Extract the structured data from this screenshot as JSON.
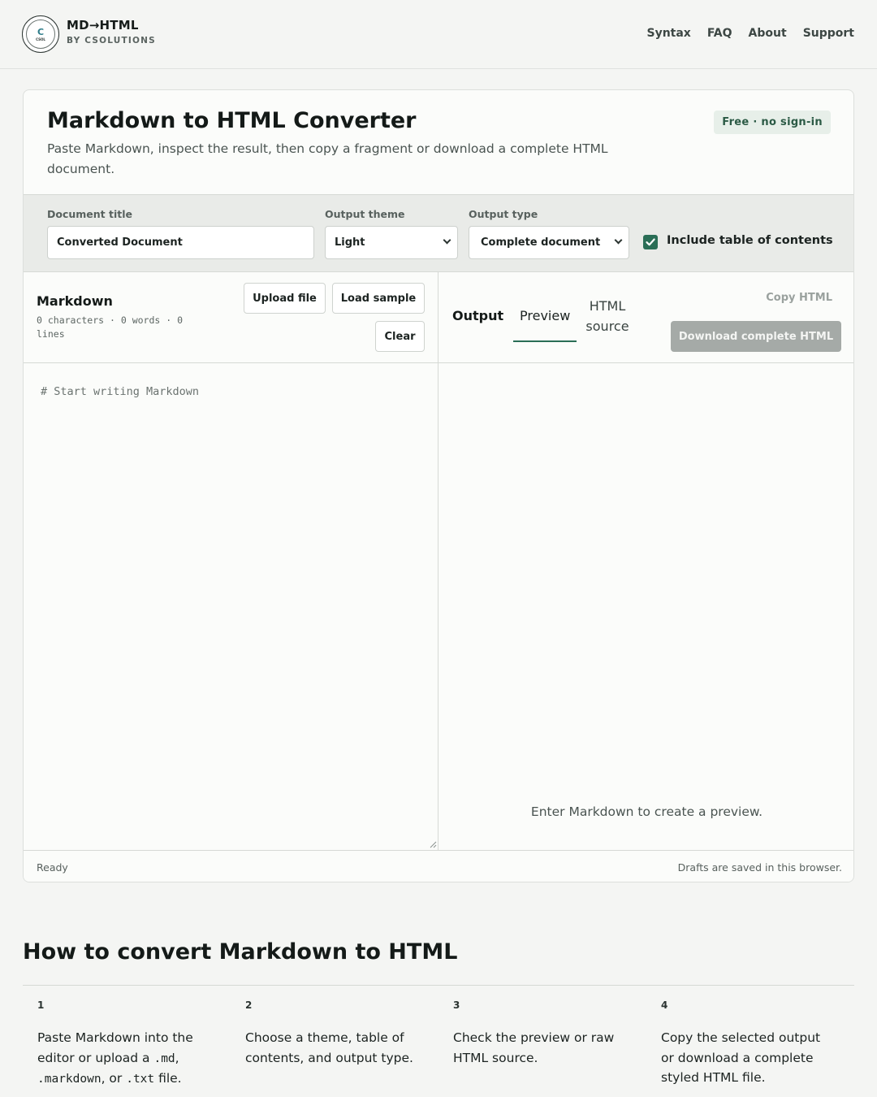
{
  "header": {
    "logo_icon": "csolutions-seal-icon",
    "brand_title": "MD→HTML",
    "brand_subtitle": "BY CSOLUTIONS",
    "nav": [
      "Syntax",
      "FAQ",
      "About",
      "Support"
    ]
  },
  "converter": {
    "title": "Markdown to HTML Converter",
    "description": "Paste Markdown, inspect the result, then copy a fragment or download a complete HTML document.",
    "badge": "Free · no sign-in",
    "controls": {
      "doc_title_label": "Document title",
      "doc_title_value": "Converted Document",
      "theme_label": "Output theme",
      "theme_value": "Light",
      "type_label": "Output type",
      "type_value": "Complete document",
      "toc_label": "Include table of contents",
      "toc_checked": true
    },
    "markdown_pane": {
      "title": "Markdown",
      "stats": "0 characters · 0 words · 0 lines",
      "upload_button": "Upload file",
      "load_sample_button": "Load sample",
      "clear_button": "Clear",
      "placeholder": "# Start writing Markdown"
    },
    "output_pane": {
      "label": "Output",
      "tab_preview": "Preview",
      "tab_html_source": "HTML source",
      "copy_button": "Copy HTML",
      "download_button": "Download complete HTML",
      "empty_message": "Enter Markdown to create a preview."
    },
    "status": {
      "left": "Ready",
      "right": "Drafts are saved in this browser."
    }
  },
  "howto": {
    "title": "How to convert Markdown to HTML",
    "steps": [
      {
        "num": "1",
        "pre": "Paste Markdown into the editor or upload a ",
        "code1": ".md",
        "mid1": ", ",
        "code2": ".markdown",
        "mid2": ", or ",
        "code3": ".txt",
        "post": " file."
      },
      {
        "num": "2",
        "text": "Choose a theme, table of contents, and output type."
      },
      {
        "num": "3",
        "text": "Check the preview or raw HTML source."
      },
      {
        "num": "4",
        "text": "Copy the selected output or download a complete styled HTML file."
      }
    ]
  },
  "colors": {
    "accent": "#2a6e56",
    "background": "#f4f5f3",
    "disabled_button": "#a5aaa7"
  }
}
